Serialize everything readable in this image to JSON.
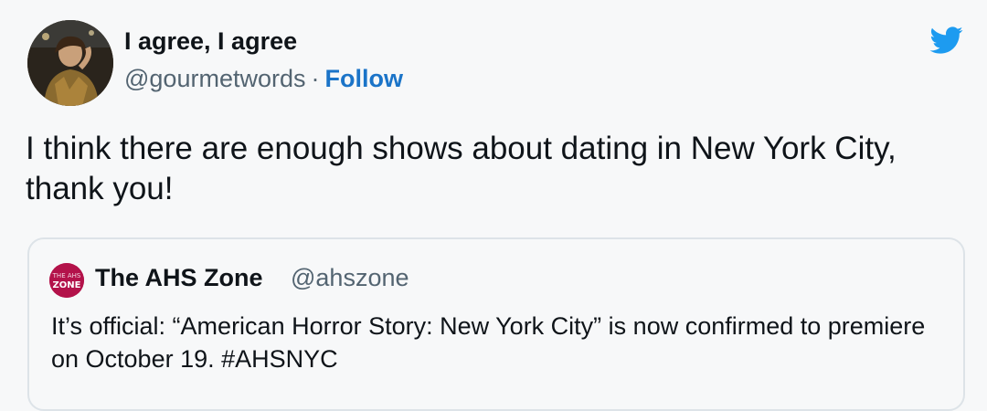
{
  "author": {
    "display_name": "I agree, I agree",
    "handle": "@gourmetwords",
    "separator": "·",
    "follow_label": "Follow"
  },
  "tweet": {
    "text": "I think there are enough shows about dating in New York City, thank you!"
  },
  "quoted_tweet": {
    "display_name": "The AHS Zone",
    "handle": "@ahszone",
    "text": "It’s official: “American Horror Story: New York City” is now confirmed to premiere on October 19. #AHSNYC",
    "avatar_text_top": "THE AHS",
    "avatar_text_bottom": "ZONE"
  },
  "icons": {
    "platform": "twitter-bird-icon"
  },
  "colors": {
    "link": "#1b74c8",
    "twitter_blue": "#1d9bf0",
    "secondary_text": "#536471",
    "quote_avatar": "#b3124a"
  }
}
